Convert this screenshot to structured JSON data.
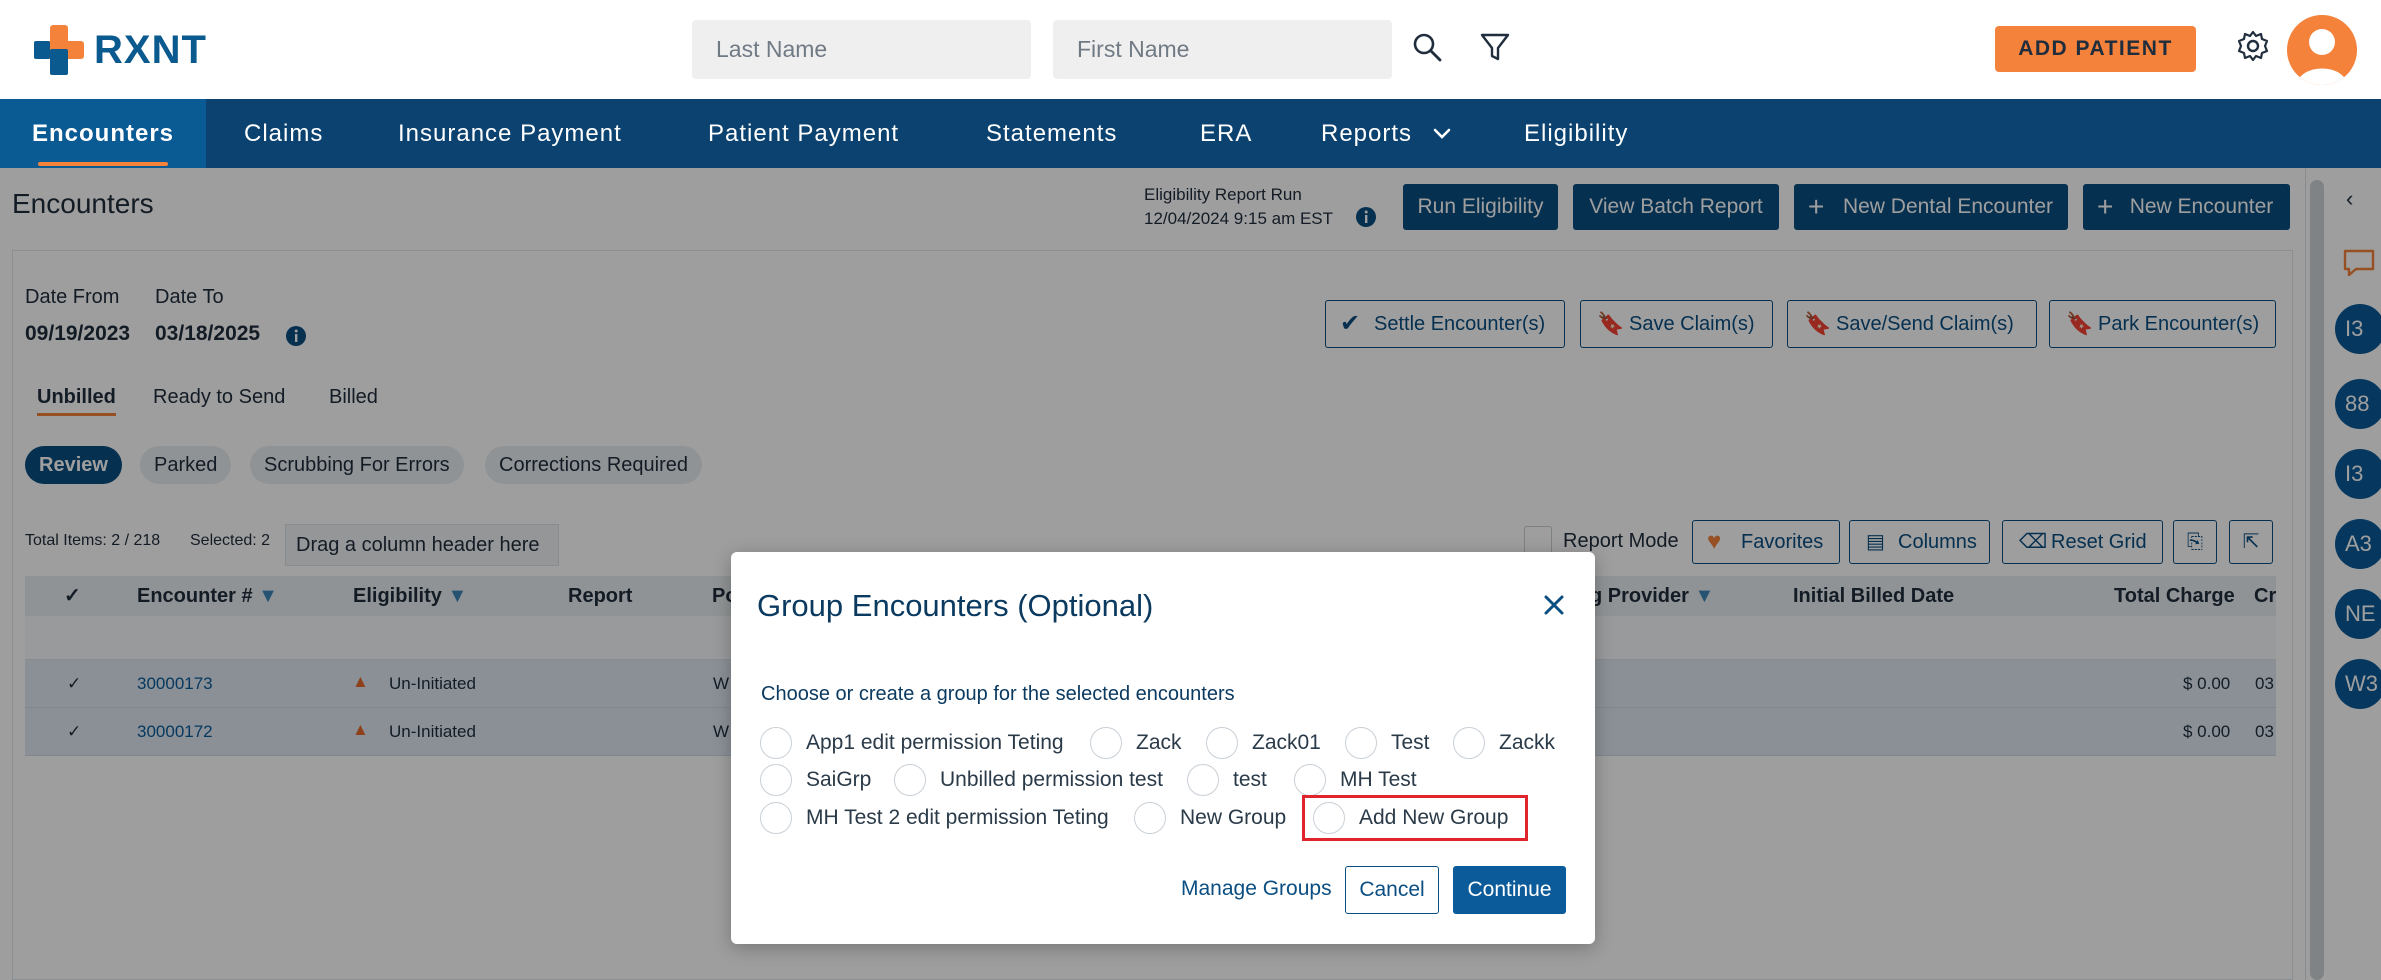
{
  "header": {
    "logo_text": "RXNT",
    "search": {
      "last_name_placeholder": "Last Name",
      "first_name_placeholder": "First Name"
    },
    "add_patient_label": "ADD PATIENT"
  },
  "nav": {
    "items": [
      "Encounters",
      "Claims",
      "Insurance Payment",
      "Patient Payment",
      "Statements",
      "ERA",
      "Reports",
      "Eligibility"
    ]
  },
  "page": {
    "title": "Encounters",
    "eligibility_run_label": "Eligibility Report Run",
    "eligibility_run_time": "12/04/2024 9:15 am EST",
    "buttons": [
      "Run Eligibility",
      "View Batch Report",
      "New Dental Encounter",
      "New Encounter"
    ],
    "date_from_label": "Date From",
    "date_from": "09/19/2023",
    "date_to_label": "Date To",
    "date_to": "03/18/2025",
    "actions": [
      "Settle Encounter(s)",
      "Save Claim(s)",
      "Save/Send Claim(s)",
      "Park Encounter(s)"
    ],
    "tabs": [
      "Unbilled",
      "Ready to Send",
      "Billed"
    ],
    "filters": [
      "Review",
      "Parked",
      "Scrubbing For Errors",
      "Corrections Required"
    ],
    "total_items": "Total Items: 2 / 218",
    "selected": "Selected: 2",
    "drag_hint": "Drag a column header here",
    "report_mode": "Report Mode",
    "grid_buttons": [
      "Favorites",
      "Columns",
      "Reset Grid"
    ],
    "columns": [
      "Encounter #",
      "Eligibility",
      "Report",
      "Po",
      "g Provider",
      "Initial Billed Date",
      "Total Charge",
      "Cr"
    ],
    "rows": [
      {
        "encounter": "30000173",
        "eligibility": "Un-Initiated",
        "po": "W",
        "charge": "$ 0.00",
        "cr": "03"
      },
      {
        "encounter": "30000172",
        "eligibility": "Un-Initiated",
        "po": "W",
        "charge": "$ 0.00",
        "cr": "03"
      }
    ]
  },
  "sidebar": {
    "bubbles": [
      "I3",
      "88",
      "I3",
      "A3",
      "NE",
      "W3"
    ]
  },
  "modal": {
    "title": "Group Encounters (Optional)",
    "subtitle": "Choose or create a group for the selected encounters",
    "options": [
      "App1 edit permission Teting",
      "Zack",
      "Zack01",
      "Test",
      "Zackk",
      "SaiGrp",
      "Unbilled permission test",
      "test",
      "MH Test",
      "MH Test 2 edit permission Teting",
      "New Group",
      "Add New Group"
    ],
    "manage_label": "Manage Groups",
    "cancel_label": "Cancel",
    "continue_label": "Continue"
  },
  "colors": {
    "nav": "#0b4270",
    "accent": "#f4823b",
    "primary": "#0b5b9a",
    "highlight": "#e0242b"
  }
}
